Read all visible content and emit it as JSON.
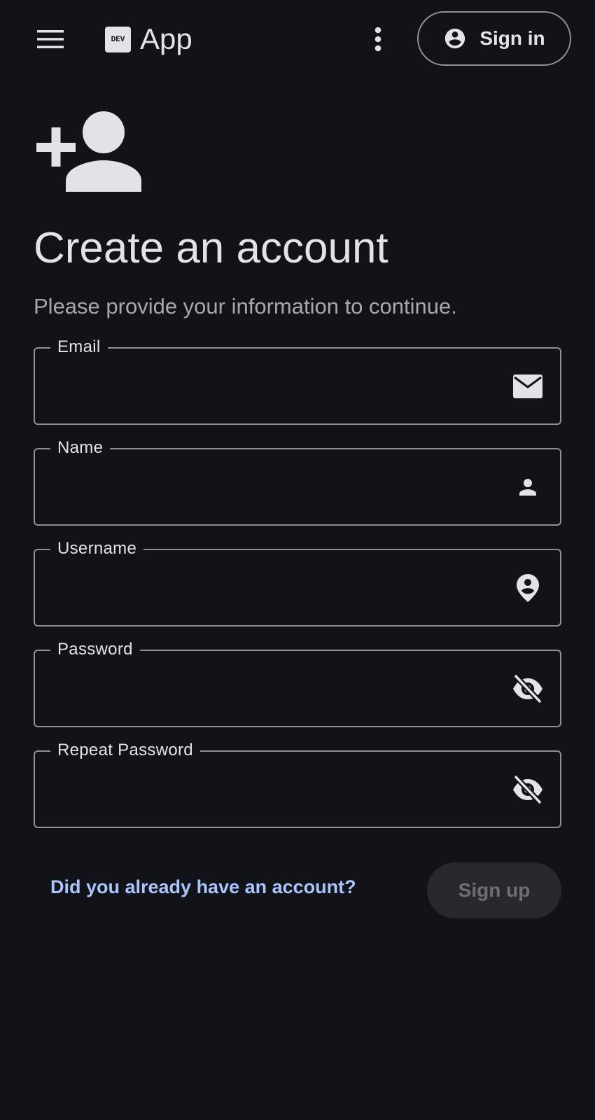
{
  "header": {
    "menu_icon": "menu-icon",
    "logo_text": "DEV",
    "app_title": "App",
    "more_icon": "more-vert-icon",
    "signin_icon": "account-circle-icon",
    "signin_label": "Sign in"
  },
  "hero": {
    "icon": "person-add-icon",
    "title": "Create an account",
    "subtitle": "Please provide your information to continue."
  },
  "form": {
    "fields": [
      {
        "label": "Email",
        "value": "",
        "icon": "mail-icon"
      },
      {
        "label": "Name",
        "value": "",
        "icon": "person-icon"
      },
      {
        "label": "Username",
        "value": "",
        "icon": "person-pin-icon"
      },
      {
        "label": "Password",
        "value": "",
        "icon": "visibility-off-icon"
      },
      {
        "label": "Repeat Password",
        "value": "",
        "icon": "visibility-off-icon"
      }
    ],
    "login_link": "Did you already have an account?",
    "submit_label": "Sign up",
    "submit_enabled": false
  },
  "colors": {
    "background": "#121318",
    "text": "#e3e2e8",
    "outline": "#8f9099",
    "link": "#a9c5fb",
    "disabled_bg": "#28292e",
    "disabled_text": "#6e6f75"
  }
}
